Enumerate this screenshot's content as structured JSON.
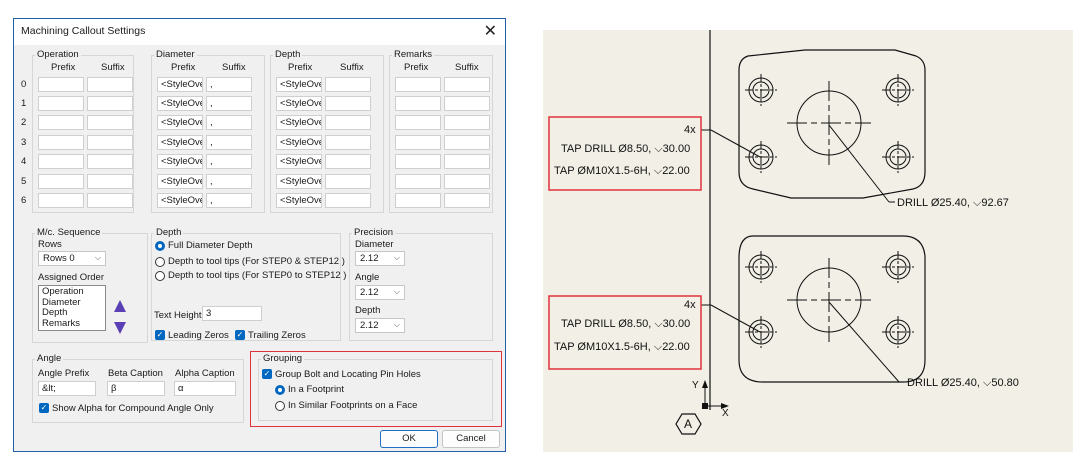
{
  "dialog": {
    "title": "Machining Callout Settings",
    "close_glyph": "✕",
    "rows_index": [
      "0",
      "1",
      "2",
      "3",
      "4",
      "5",
      "6"
    ],
    "operation": {
      "title": "Operation",
      "prefix": "Prefix",
      "suffix": "Suffix"
    },
    "diameter": {
      "title": "Diameter",
      "prefix": "Prefix",
      "suffix": "Suffix",
      "prefix_values": [
        "<StyleOver",
        "<StyleOver",
        "<StyleOver",
        "<StyleOver",
        "<StyleOver",
        "<StyleOver",
        "<StyleOver"
      ],
      "suffix_values": [
        ",",
        ",",
        ",",
        ",",
        ",",
        ",",
        ","
      ]
    },
    "depth_table": {
      "title": "Depth",
      "prefix": "Prefix",
      "suffix": "Suffix",
      "prefix_values": [
        "<StyleOver",
        "<StyleOver",
        "<StyleOver",
        "<StyleOver",
        "<StyleOver",
        "<StyleOver",
        "<StyleOver"
      ]
    },
    "remarks": {
      "title": "Remarks",
      "prefix": "Prefix",
      "suffix": "Suffix"
    },
    "mc_sequence": {
      "title": "M/c. Sequence",
      "rows_label": "Rows",
      "rows_value": "Rows 0",
      "assigned_order_label": "Assigned Order",
      "order_items": [
        "Operation",
        "Diameter",
        "Depth",
        "Remarks"
      ]
    },
    "depth_options": {
      "title": "Depth",
      "options": [
        "Full Diameter Depth",
        "Depth to tool tips (For STEP0 & STEP12 )",
        "Depth to tool tips (For STEP0 to STEP12 )"
      ],
      "selected_index": 0,
      "text_height_label": "Text Height",
      "text_height_value": "3",
      "leading_zeros": "Leading Zeros",
      "trailing_zeros": "Trailing Zeros"
    },
    "precision": {
      "title": "Precision",
      "diameter_label": "Diameter",
      "diameter_value": "2.12",
      "angle_label": "Angle",
      "angle_value": "2.12",
      "depth_label": "Depth",
      "depth_value": "2.12"
    },
    "angle": {
      "title": "Angle",
      "prefix_label": "Angle Prefix",
      "prefix_value": "&lt;",
      "beta_label": "Beta Caption",
      "beta_value": "β",
      "alpha_label": "Alpha Caption",
      "alpha_value": "α",
      "show_alpha": "Show Alpha for Compound Angle Only"
    },
    "grouping": {
      "title": "Grouping",
      "group_check": "Group Bolt and Locating Pin Holes",
      "options": [
        "In a Footprint",
        "In Similar Footprints on a Face"
      ],
      "selected_index": 0
    },
    "ok": "OK",
    "cancel": "Cancel"
  },
  "drawing": {
    "top": {
      "count": "4x",
      "tap_drill": "TAP DRILL Ø8.50,  ⌵30.00",
      "tap": "TAP  ØM10X1.5-6H,  ⌵22.00",
      "drill": "DRILL Ø25.40,  ⌵92.67"
    },
    "bottom": {
      "count": "4x",
      "tap_drill": "TAP DRILL Ø8.50,  ⌵30.00",
      "tap": "TAP  ØM10X1.5-6H,  ⌵22.00",
      "drill": "DRILL Ø25.40,  ⌵50.80"
    },
    "axis_y": "Y",
    "axis_x": "X",
    "datum": "A",
    "colors": {
      "highlight": "#e0323a",
      "accent": "#0067c0",
      "paper": "#f1efe6"
    }
  }
}
